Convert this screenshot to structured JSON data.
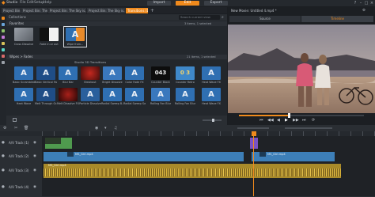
{
  "app": {
    "logo_text": "Studio",
    "menus": [
      "File",
      "Edit",
      "Setup",
      "Help"
    ],
    "modes": [
      {
        "label": "Import",
        "active": false
      },
      {
        "label": "Edit",
        "active": true
      },
      {
        "label": "Export",
        "active": false
      }
    ],
    "window_buttons": [
      "?",
      "–",
      "□",
      "×"
    ]
  },
  "project_tabs": [
    {
      "label": "Project Bin",
      "active": false
    },
    {
      "label": "Project Bin: The Sky is...",
      "active": false
    },
    {
      "label": "Project Bin: The Sky is...",
      "active": false
    },
    {
      "label": "Project Bin: The Sky is...",
      "active": false
    },
    {
      "label": "Transitions (14)",
      "active": true
    }
  ],
  "library": {
    "collection_label": "Collections",
    "search_placeholder": "Search current view",
    "favorites": {
      "title": "Favorites",
      "count": "3 items, 1 selected",
      "items": [
        {
          "label": "Cross Dissolve",
          "thumb": "gray"
        },
        {
          "label": "Fade in or out",
          "thumb": "blackwhite"
        },
        {
          "label": "Wipe from...",
          "thumb": "wipe"
        }
      ]
    },
    "wipes": {
      "title": "Wipes > Fades",
      "center_title": "Studio 3D Transitions",
      "count": "21 items, 1 selected",
      "row1": [
        {
          "label": "Basic Scrambled Sli...",
          "thumb": "blueA"
        },
        {
          "label": "Basic Vertical Fan...",
          "thumb": "blueA"
        },
        {
          "label": "Blur Bar",
          "thumb": "blueA"
        },
        {
          "label": "Breakout",
          "thumb": "red"
        },
        {
          "label": "Bright Dissolve",
          "thumb": "blueA"
        },
        {
          "label": "Color Fade FX",
          "thumb": "blueA"
        },
        {
          "label": "Counter Black",
          "thumb": "num1"
        },
        {
          "label": "Counter Retro",
          "thumb": "num2"
        },
        {
          "label": "Heat Wave FX",
          "thumb": "blueA"
        }
      ],
      "row2": [
        {
          "label": "Heat Wave",
          "thumb": "blueA"
        },
        {
          "label": "Melt Through Gr...",
          "thumb": "blueA"
        },
        {
          "label": "Melt Dissolve FX",
          "thumb": "red"
        },
        {
          "label": "Particle Dissolve",
          "thumb": "blueA"
        },
        {
          "label": "Radial Sweep B...",
          "thumb": "blueA"
        },
        {
          "label": "Radial Sweep Sw...",
          "thumb": "blueA"
        },
        {
          "label": "Rolling Fan Blur",
          "thumb": "blueA"
        },
        {
          "label": "Rolling Fan Blur",
          "thumb": "blueA"
        },
        {
          "label": "Heat Wave FX",
          "thumb": "blueA"
        }
      ],
      "counters": [
        "043",
        "0 3"
      ]
    }
  },
  "preview": {
    "title": "New Movie: Untitled 4.mp4 *",
    "tabs": [
      {
        "label": "Source",
        "active": false
      },
      {
        "label": "Timeline",
        "active": true
      }
    ],
    "controls": [
      "⏮",
      "◀◀",
      "◀",
      "▶",
      "▶▶",
      "⏭",
      "⟳"
    ]
  },
  "timeline": {
    "tracks": [
      {
        "name": "A/V Track (1)"
      },
      {
        "name": "A/V Track (2)"
      },
      {
        "name": "A/V Track (3)"
      },
      {
        "name": "A/V Track (4)"
      }
    ],
    "clips": {
      "track2": [
        "MS_Girl.mp4",
        "MS_Girl.mp4"
      ],
      "track3": [
        "MS_Girl.mp4"
      ]
    }
  },
  "colors": {
    "accent": "#f08a1c",
    "blue_clip": "#3d7fb8",
    "green_clip": "#4f9a4e",
    "audio_wave": "#d8b23a",
    "purple_marker": "#7a52c4"
  }
}
